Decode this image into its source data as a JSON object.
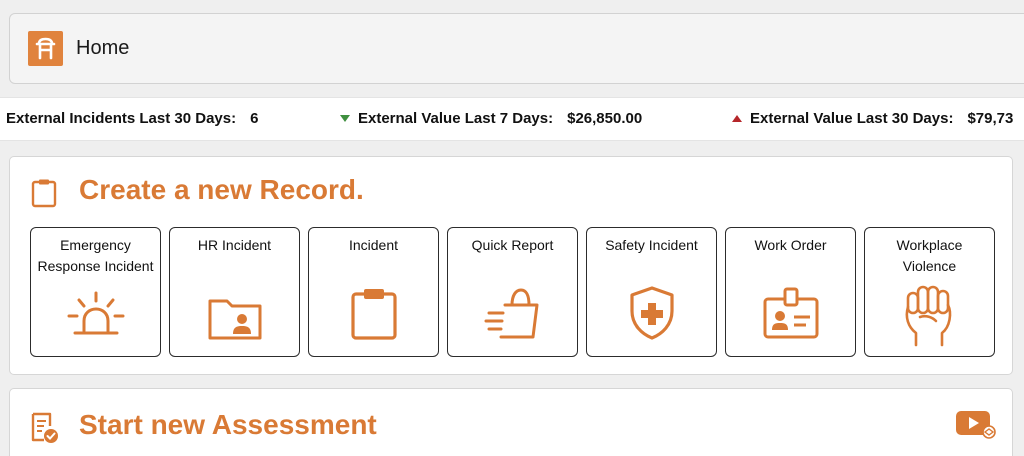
{
  "header": {
    "title": "Home"
  },
  "ticker": [
    {
      "label": "External Incidents Last 30 Days:",
      "value": "6",
      "trend": "none"
    },
    {
      "label": "External Value Last 7 Days:",
      "value": "$26,850.00",
      "trend": "down"
    },
    {
      "label": "External Value Last 30 Days:",
      "value": "$79,73",
      "trend": "up"
    }
  ],
  "colors": {
    "accent": "#d97a35",
    "trend_down": "#3f8f3f",
    "trend_up": "#b5262a"
  },
  "record_section": {
    "title": "Create a new Record.",
    "icon": "clipboard-icon",
    "cards": [
      {
        "label": "Emergency Response Incident",
        "icon": "siren-icon"
      },
      {
        "label": "HR Incident",
        "icon": "user-folder-icon"
      },
      {
        "label": "Incident",
        "icon": "clipboard-icon"
      },
      {
        "label": "Quick Report",
        "icon": "fast-shopping-bag-icon"
      },
      {
        "label": "Safety Incident",
        "icon": "shield-plus-icon"
      },
      {
        "label": "Work Order",
        "icon": "id-badge-icon"
      },
      {
        "label": "Workplace Violence",
        "icon": "raised-fist-icon"
      }
    ]
  },
  "assessment_section": {
    "title": "Start new Assessment",
    "icon": "certificate-check-icon",
    "video_icon": "video-tutorial-icon"
  }
}
